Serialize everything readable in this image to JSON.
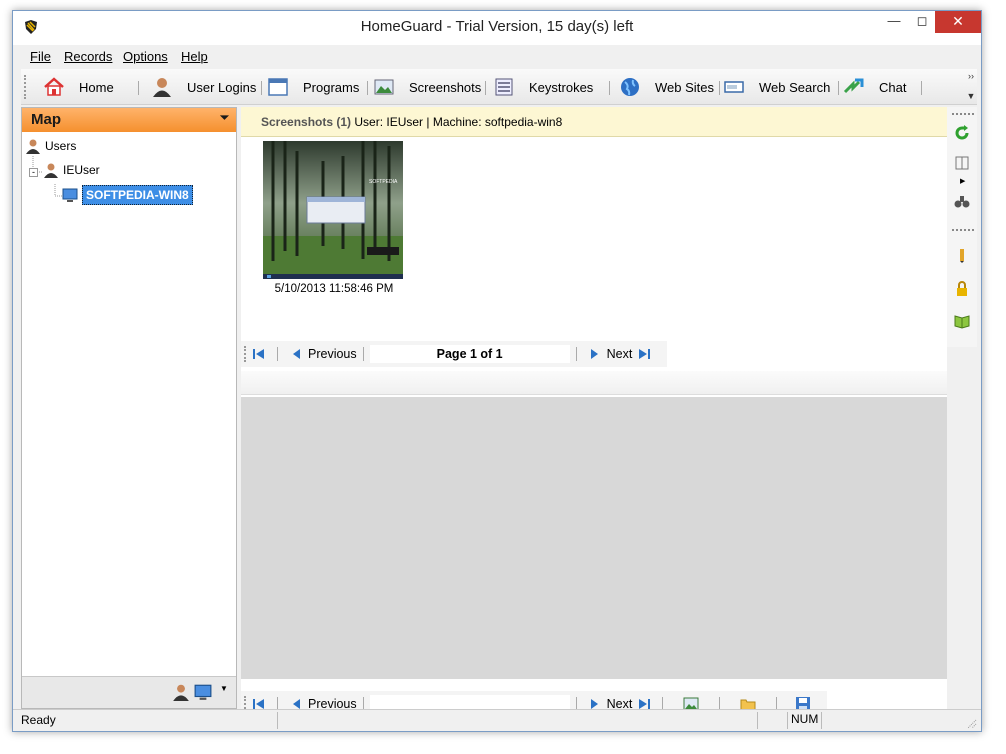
{
  "window": {
    "title": "HomeGuard - Trial Version, 15 day(s) left"
  },
  "menu": [
    {
      "label": "File"
    },
    {
      "label": "Records"
    },
    {
      "label": "Options"
    },
    {
      "label": "Help"
    }
  ],
  "toolbar": {
    "items": [
      {
        "label": "Home",
        "icon": "home-icon"
      },
      {
        "label": "User Logins",
        "icon": "user-icon"
      },
      {
        "label": "Programs",
        "icon": "window-icon"
      },
      {
        "label": "Screenshots",
        "icon": "picture-icon"
      },
      {
        "label": "Keystrokes",
        "icon": "keyboard-icon"
      },
      {
        "label": "Web Sites",
        "icon": "globe-icon"
      },
      {
        "label": "Web Search",
        "icon": "search-box-icon"
      },
      {
        "label": "Chat",
        "icon": "chat-arrows-icon"
      }
    ]
  },
  "map": {
    "title": "Map",
    "tree": {
      "root": "Users",
      "user": "IEUser",
      "machine": "SOFTPEDIA-WIN8"
    }
  },
  "screenshots": {
    "header_bold": "Screenshots (1)",
    "header_user": "User: IEUser",
    "header_machine": "Machine: softpedia-win8",
    "items": [
      {
        "date": "5/10/2013 11:58:46 PM",
        "thumb_title": "SOFTPEDIA"
      }
    ],
    "pager": {
      "previous": "Previous",
      "page": "Page 1 of 1",
      "next": "Next"
    }
  },
  "bottom_pager": {
    "previous": "Previous",
    "next": "Next"
  },
  "status": {
    "text": "Ready",
    "num": "NUM"
  },
  "colors": {
    "accent": "#f5902e",
    "selection": "#3d8ee6",
    "header_bg": "#fdf7d3",
    "close": "#c7372f"
  }
}
